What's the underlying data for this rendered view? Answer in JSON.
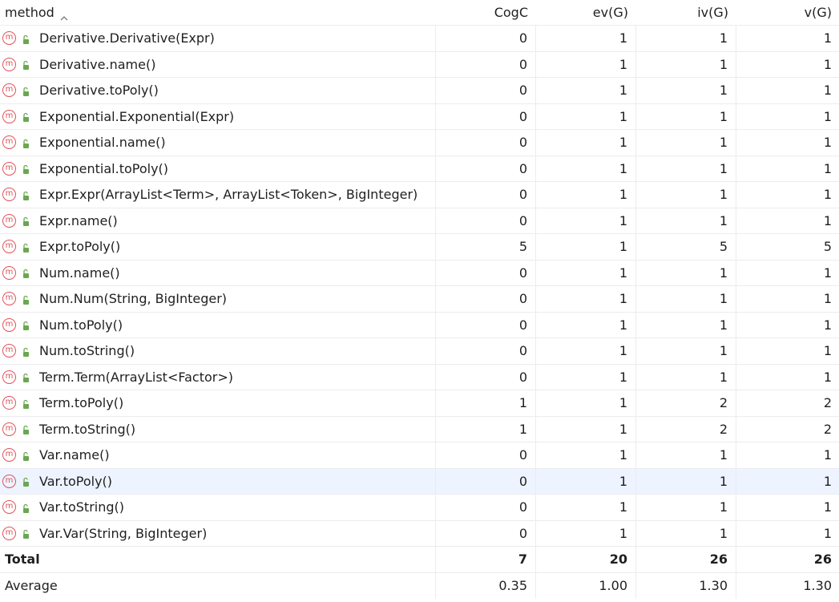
{
  "header": {
    "method": "method",
    "cogc": "CogC",
    "ev": "ev(G)",
    "iv": "iv(G)",
    "v": "v(G)",
    "sort": "ascending"
  },
  "rows": [
    {
      "method": "Derivative.Derivative(Expr)",
      "cogc": "0",
      "ev": "1",
      "iv": "1",
      "v": "1"
    },
    {
      "method": "Derivative.name()",
      "cogc": "0",
      "ev": "1",
      "iv": "1",
      "v": "1"
    },
    {
      "method": "Derivative.toPoly()",
      "cogc": "0",
      "ev": "1",
      "iv": "1",
      "v": "1"
    },
    {
      "method": "Exponential.Exponential(Expr)",
      "cogc": "0",
      "ev": "1",
      "iv": "1",
      "v": "1"
    },
    {
      "method": "Exponential.name()",
      "cogc": "0",
      "ev": "1",
      "iv": "1",
      "v": "1"
    },
    {
      "method": "Exponential.toPoly()",
      "cogc": "0",
      "ev": "1",
      "iv": "1",
      "v": "1"
    },
    {
      "method": "Expr.Expr(ArrayList<Term>, ArrayList<Token>, BigInteger)",
      "cogc": "0",
      "ev": "1",
      "iv": "1",
      "v": "1"
    },
    {
      "method": "Expr.name()",
      "cogc": "0",
      "ev": "1",
      "iv": "1",
      "v": "1"
    },
    {
      "method": "Expr.toPoly()",
      "cogc": "5",
      "ev": "1",
      "iv": "5",
      "v": "5"
    },
    {
      "method": "Num.name()",
      "cogc": "0",
      "ev": "1",
      "iv": "1",
      "v": "1"
    },
    {
      "method": "Num.Num(String, BigInteger)",
      "cogc": "0",
      "ev": "1",
      "iv": "1",
      "v": "1"
    },
    {
      "method": "Num.toPoly()",
      "cogc": "0",
      "ev": "1",
      "iv": "1",
      "v": "1"
    },
    {
      "method": "Num.toString()",
      "cogc": "0",
      "ev": "1",
      "iv": "1",
      "v": "1"
    },
    {
      "method": "Term.Term(ArrayList<Factor>)",
      "cogc": "0",
      "ev": "1",
      "iv": "1",
      "v": "1"
    },
    {
      "method": "Term.toPoly()",
      "cogc": "1",
      "ev": "1",
      "iv": "2",
      "v": "2"
    },
    {
      "method": "Term.toString()",
      "cogc": "1",
      "ev": "1",
      "iv": "2",
      "v": "2"
    },
    {
      "method": "Var.name()",
      "cogc": "0",
      "ev": "1",
      "iv": "1",
      "v": "1"
    },
    {
      "method": "Var.toPoly()",
      "cogc": "0",
      "ev": "1",
      "iv": "1",
      "v": "1",
      "selected": true
    },
    {
      "method": "Var.toString()",
      "cogc": "0",
      "ev": "1",
      "iv": "1",
      "v": "1"
    },
    {
      "method": "Var.Var(String, BigInteger)",
      "cogc": "0",
      "ev": "1",
      "iv": "1",
      "v": "1"
    }
  ],
  "total": {
    "label": "Total",
    "cogc": "7",
    "ev": "20",
    "iv": "26",
    "v": "26"
  },
  "average": {
    "label": "Average",
    "cogc": "0.35",
    "ev": "1.00",
    "iv": "1.30",
    "v": "1.30"
  },
  "icons": {
    "method_icon": "method-icon",
    "method_icon_glyph": "m",
    "visibility_icon": "public-lock-icon"
  },
  "colors": {
    "method_icon": "#e0525b",
    "lock_icon": "#6aa84f",
    "selected_row": "#edf3ff",
    "grid_line": "#ebecf0"
  }
}
